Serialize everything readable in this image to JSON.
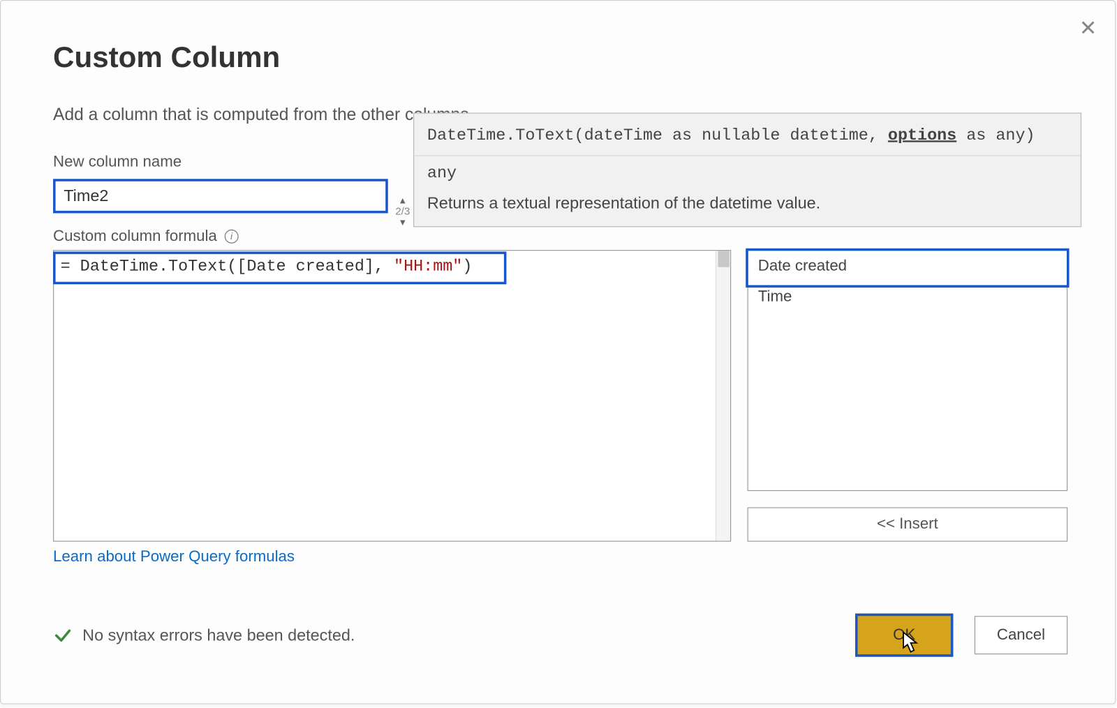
{
  "dialog": {
    "title": "Custom Column",
    "subtitle": "Add a column that is computed from the other columns.",
    "close_glyph": "✕"
  },
  "new_column": {
    "label": "New column name",
    "value": "Time2"
  },
  "spinner": {
    "counter": "2/3"
  },
  "formula": {
    "label": "Custom column formula",
    "prefix": "= DateTime.ToText([Date created], ",
    "string_literal": "\"HH:mm\"",
    "suffix": ")"
  },
  "tooltip": {
    "signature_pre": "DateTime.ToText(dateTime as nullable datetime, ",
    "signature_active": "options",
    "signature_post": " as any)",
    "return_type": "any",
    "description": "Returns a textual representation of the datetime value."
  },
  "available": {
    "items": [
      "Date created",
      "Time"
    ],
    "selected_index": 0
  },
  "buttons": {
    "insert": "<< Insert",
    "ok": "OK",
    "cancel": "Cancel"
  },
  "link": {
    "learn": "Learn about Power Query formulas"
  },
  "status": {
    "message": "No syntax errors have been detected."
  }
}
